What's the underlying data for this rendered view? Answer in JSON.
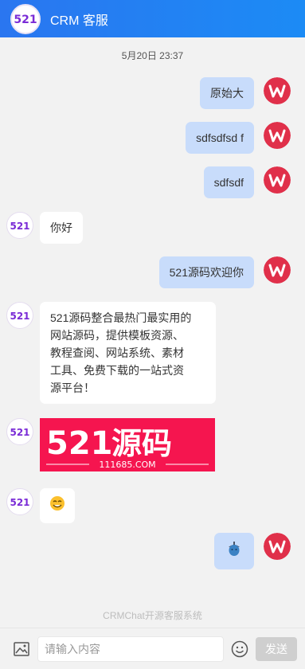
{
  "header": {
    "title": "CRM 客服",
    "logo_text": "521"
  },
  "timestamp": "5月20日 23:37",
  "messages": [
    {
      "text": "原始大"
    },
    {
      "text": "sdfsdfsd f"
    },
    {
      "text": "sdfsdf"
    },
    {
      "text": "你好"
    },
    {
      "text": "521源码欢迎你"
    },
    {
      "lines": [
        "521源码整合最热门最实用的",
        "网站源码，提供模板资源、",
        "教程查阅、网站系统、素材",
        "工具、免费下载的一站式资",
        "源平台！"
      ]
    }
  ],
  "banner": {
    "brand": "521源码",
    "brand_num": "521",
    "brand_cn": "源码",
    "url": "111685.COM"
  },
  "footer_note": "CRMChat开源客服系统",
  "input": {
    "placeholder": "请输入内容",
    "send_label": "发送"
  },
  "colors": {
    "header_start": "#2a76f0",
    "header_end": "#1c8bf5",
    "my_bubble": "#c8dcfb",
    "banner": "#f5154f"
  }
}
